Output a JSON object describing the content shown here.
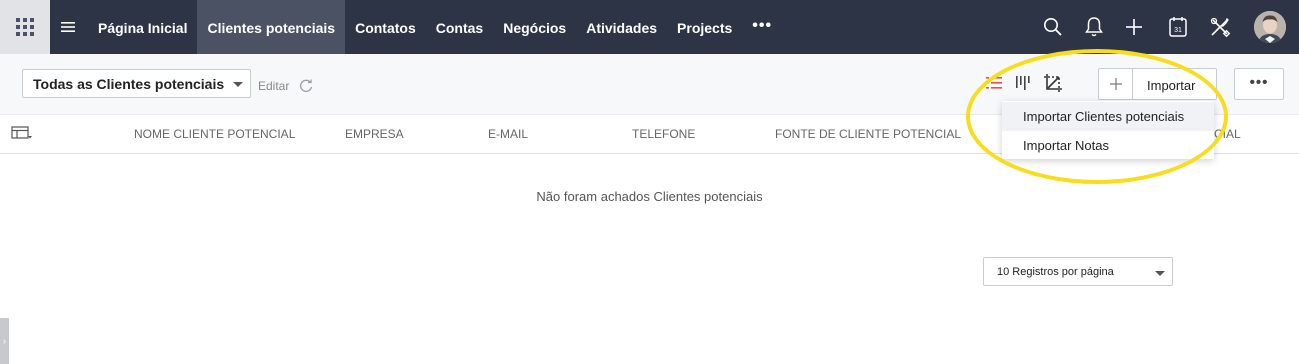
{
  "topnav": {
    "items": [
      {
        "label": "Página Inicial"
      },
      {
        "label": "Clientes potenciais"
      },
      {
        "label": "Contatos"
      },
      {
        "label": "Contas"
      },
      {
        "label": "Negócios"
      },
      {
        "label": "Atividades"
      },
      {
        "label": "Projects"
      }
    ],
    "active_item": "Clientes potenciais",
    "more_label": "•••",
    "icons": [
      "apps-grid-icon",
      "menu-icon",
      "search-icon",
      "bell-icon",
      "plus-icon",
      "calendar-icon",
      "tools-icon",
      "avatar"
    ],
    "calendar_day": "31"
  },
  "toolbar": {
    "view_select_value": "Todas as Clientes potenciais",
    "edit_label": "Editar",
    "import_label": "Importar",
    "more_label": "•••"
  },
  "table": {
    "columns": [
      "NOME CLIENTE POTENCIAL",
      "EMPRESA",
      "E-MAIL",
      "TELEFONE",
      "FONTE DE CLIENTE POTENCIAL",
      "CIAL"
    ],
    "empty_message": "Não foram achados Clientes potenciais"
  },
  "pagination": {
    "per_page_label": "10 Registros por página"
  },
  "import_menu": {
    "items": [
      "Importar Clientes potenciais",
      "Importar Notas"
    ]
  },
  "colors": {
    "topbar": "#2d3446",
    "active_tab": "#4a5264",
    "highlight": "#f7dd1e",
    "list_icon_accent": "#e8504a"
  }
}
